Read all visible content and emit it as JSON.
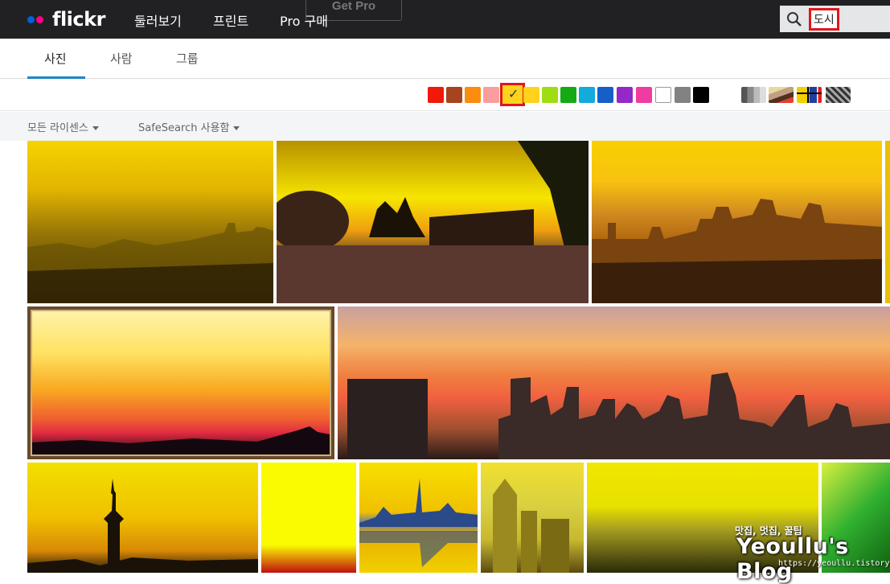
{
  "header": {
    "logo_text": "flickr",
    "logo_dot_colors": [
      "#0063dc",
      "#ff0084"
    ],
    "nav": [
      "둘러보기",
      "프린트",
      "Pro 구매"
    ],
    "get_pro_label": "Get Pro",
    "search_value": "도시"
  },
  "tabs": [
    "사진",
    "사람",
    "그룹"
  ],
  "active_tab": "사진",
  "color_filter": {
    "colors": [
      "#f0190a",
      "#a5441e",
      "#fa8c0f",
      "#fa9d9d",
      "#ffd21b",
      "#ffd21b",
      "#a0dc14",
      "#14aa14",
      "#14aadc",
      "#1460c8",
      "#9628c8",
      "#f03ca0",
      "#ffffff",
      "#828282",
      "#000000"
    ],
    "selected_index": 4,
    "selected_mark": "✓",
    "style_swatches": [
      "black-and-white",
      "shallow-depth-of-field",
      "minimalist",
      "patterns"
    ]
  },
  "filters": {
    "license_label": "모든 라이센스",
    "safesearch_label": "SafeSearch 사용함"
  },
  "photos": [
    {
      "name": "photo-hazy-yellow-city",
      "colors": [
        "#f5d400",
        "#9c7a06",
        "#3a2a02"
      ]
    },
    {
      "name": "photo-virtual-island-sunset",
      "colors": [
        "#f6e500",
        "#e08a10",
        "#2a1a10"
      ]
    },
    {
      "name": "photo-paris-la-defense",
      "colors": [
        "#f7c210",
        "#b36a10",
        "#3a200a"
      ]
    },
    {
      "name": "photo-framed-orange-sunset",
      "colors": [
        "#fff3a8",
        "#f8a820",
        "#e22a40"
      ]
    },
    {
      "name": "photo-city-skyline-orange-sky",
      "colors": [
        "#f5b36a",
        "#f06040",
        "#2a1a18"
      ]
    },
    {
      "name": "photo-galata-tower",
      "colors": [
        "#f2e000",
        "#d88a06",
        "#1a1208"
      ]
    },
    {
      "name": "photo-yellow-red-town",
      "colors": [
        "#fafa00",
        "#fafa00",
        "#c01010"
      ]
    },
    {
      "name": "photo-dubai-reflection",
      "colors": [
        "#f8e000",
        "#e8b000",
        "#2a4a8a"
      ]
    },
    {
      "name": "photo-yellow-skyscrapers",
      "colors": [
        "#f0e030",
        "#c8b830",
        "#5a4a10"
      ]
    },
    {
      "name": "photo-yellow-aerial-city",
      "colors": [
        "#e8e000",
        "#a8a020",
        "#2a2a0a"
      ]
    },
    {
      "name": "photo-green-tower",
      "colors": [
        "#d8f040",
        "#30b030",
        "#106010"
      ]
    }
  ],
  "watermark": {
    "subtitle": "맛집, 멋집, 꿀팁",
    "title": "Yeoullu's Blog",
    "url": "https://yeoullu.tistory.com"
  }
}
